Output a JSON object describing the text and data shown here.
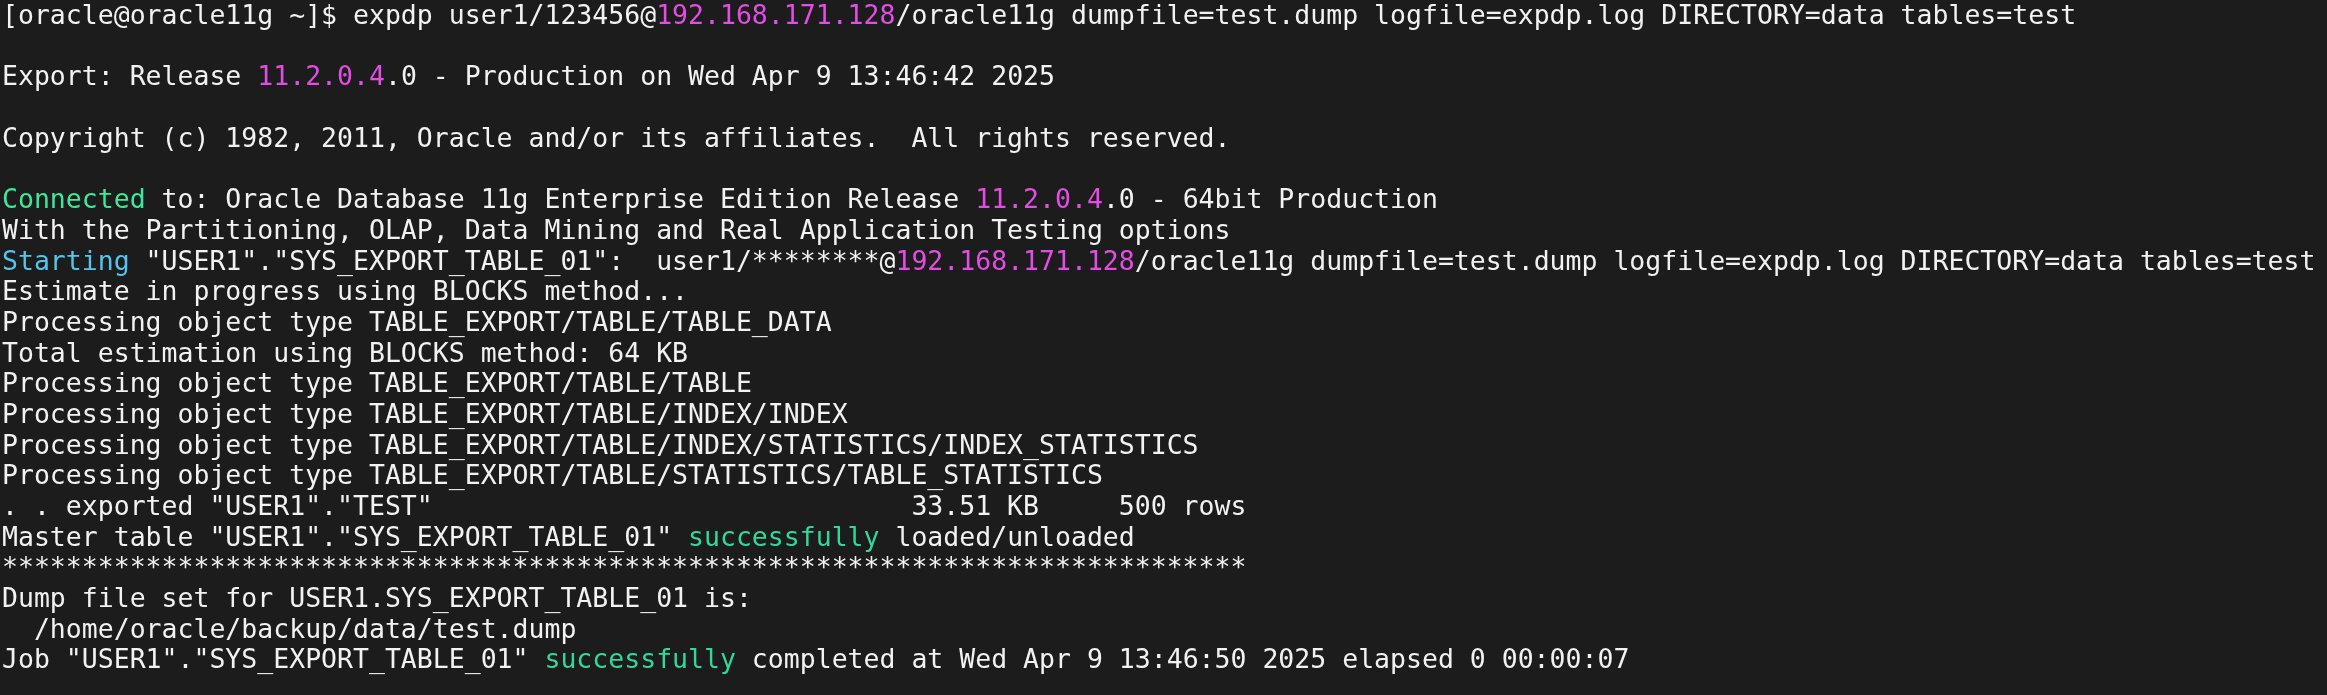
{
  "terminal": {
    "lines": [
      {
        "kind": "text",
        "segments": [
          {
            "text": "[oracle@oracle11g ~]$ expdp user1/123456@"
          },
          {
            "text": "192.168.171.128",
            "color": "#e44ce6"
          },
          {
            "text": "/oracle11g dumpfile=test.dump logfile=expdp.log DIRECTORY=data tables=test"
          }
        ]
      },
      {
        "kind": "blank"
      },
      {
        "kind": "text",
        "segments": [
          {
            "text": "Export: Release "
          },
          {
            "text": "11.2.0.4",
            "color": "#e44ce6"
          },
          {
            "text": ".0 - Production on Wed Apr 9 13:46:42 2025"
          }
        ]
      },
      {
        "kind": "blank"
      },
      {
        "kind": "text",
        "segments": [
          {
            "text": "Copyright (c) 1982, 2011, Oracle and/or its affiliates.  All rights reserved."
          }
        ]
      },
      {
        "kind": "blank"
      },
      {
        "kind": "text",
        "segments": [
          {
            "text": "Connected",
            "color": "#3ee89a"
          },
          {
            "text": " to: Oracle Database 11g Enterprise Edition Release "
          },
          {
            "text": "11.2.0.4",
            "color": "#e44ce6"
          },
          {
            "text": ".0 - 64bit Production"
          }
        ]
      },
      {
        "kind": "text",
        "segments": [
          {
            "text": "With the Partitioning, OLAP, Data Mining and Real Application Testing options"
          }
        ]
      },
      {
        "kind": "text",
        "segments": [
          {
            "text": "Starting",
            "color": "#56c4ea"
          },
          {
            "text": " \"USER1\".\"SYS_EXPORT_TABLE_01\":  user1/********@"
          },
          {
            "text": "192.168.171.128",
            "color": "#e44ce6"
          },
          {
            "text": "/oracle11g dumpfile=test.dump logfile=expdp.log DIRECTORY=data tables=test"
          }
        ]
      },
      {
        "kind": "text",
        "segments": [
          {
            "text": "Estimate in progress using BLOCKS method..."
          }
        ]
      },
      {
        "kind": "text",
        "segments": [
          {
            "text": "Processing object type TABLE_EXPORT/TABLE/TABLE_DATA"
          }
        ]
      },
      {
        "kind": "text",
        "segments": [
          {
            "text": "Total estimation using BLOCKS method: 64 KB"
          }
        ]
      },
      {
        "kind": "text",
        "segments": [
          {
            "text": "Processing object type TABLE_EXPORT/TABLE/TABLE"
          }
        ]
      },
      {
        "kind": "text",
        "segments": [
          {
            "text": "Processing object type TABLE_EXPORT/TABLE/INDEX/INDEX"
          }
        ]
      },
      {
        "kind": "text",
        "segments": [
          {
            "text": "Processing object type TABLE_EXPORT/TABLE/INDEX/STATISTICS/INDEX_STATISTICS"
          }
        ]
      },
      {
        "kind": "text",
        "segments": [
          {
            "text": "Processing object type TABLE_EXPORT/TABLE/STATISTICS/TABLE_STATISTICS"
          }
        ]
      },
      {
        "kind": "text",
        "segments": [
          {
            "text": ". . exported \"USER1\".\"TEST\"                              33.51 KB     500 rows"
          }
        ]
      },
      {
        "kind": "text",
        "segments": [
          {
            "text": "Master table \"USER1\".\"SYS_EXPORT_TABLE_01\" "
          },
          {
            "text": "successfully",
            "color": "#30d99a"
          },
          {
            "text": " loaded/unloaded"
          }
        ]
      },
      {
        "kind": "text",
        "segments": [
          {
            "text": "******************************************************************************"
          }
        ]
      },
      {
        "kind": "text",
        "segments": [
          {
            "text": "Dump file set for USER1.SYS_EXPORT_TABLE_01 is:"
          }
        ]
      },
      {
        "kind": "text",
        "segments": [
          {
            "text": "  /home/oracle/backup/data/test.dump"
          }
        ]
      },
      {
        "kind": "text",
        "segments": [
          {
            "text": "Job \"USER1\".\"SYS_EXPORT_TABLE_01\" "
          },
          {
            "text": "successfully",
            "color": "#30d99a"
          },
          {
            "text": " completed at Wed Apr 9 13:46:50 2025 elapsed 0 00:00:07"
          }
        ]
      }
    ]
  }
}
